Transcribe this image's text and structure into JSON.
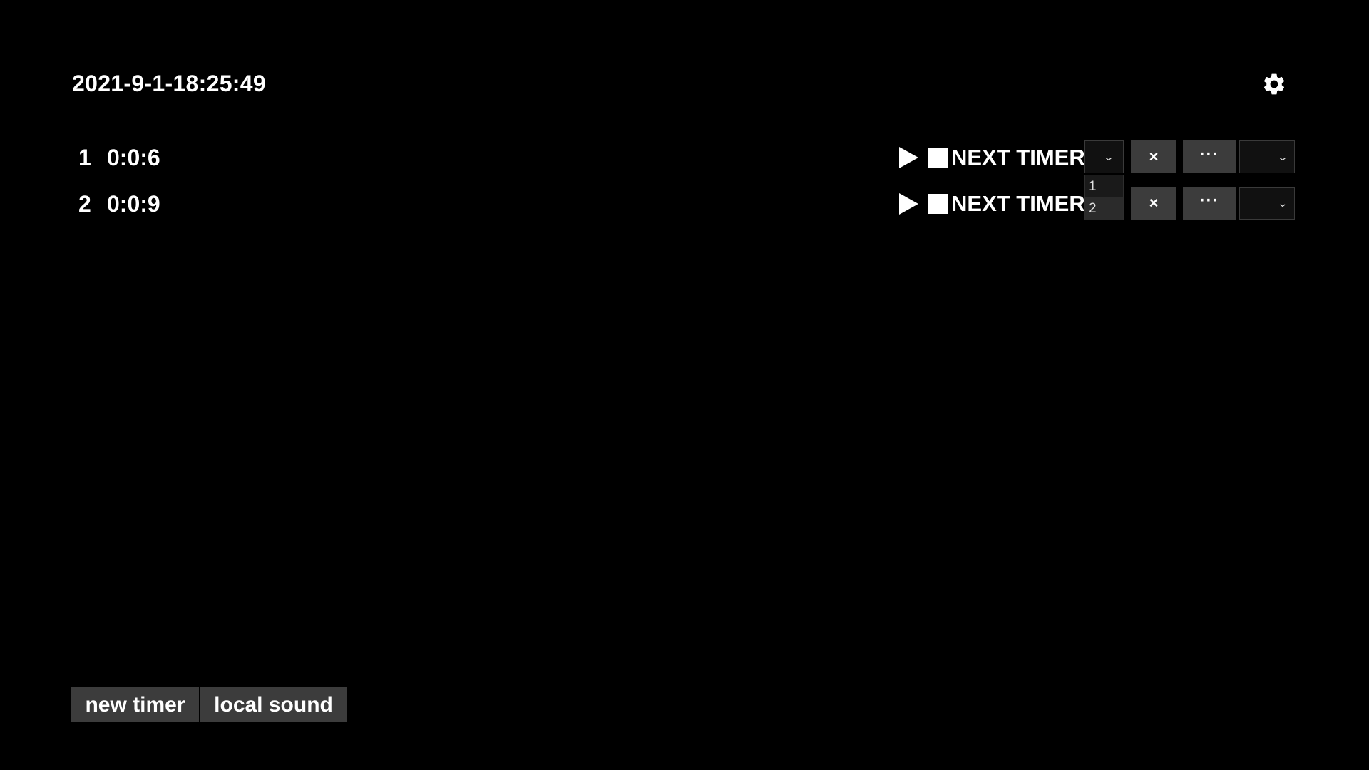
{
  "clock": {
    "datetime": "2021-9-1-18:25:49"
  },
  "header": {
    "settings_icon": "gear-icon"
  },
  "timers": [
    {
      "index": "1",
      "time": "0:0:6",
      "next_label": "NEXT TIMER",
      "delete_label": "×",
      "more_label": "···"
    },
    {
      "index": "2",
      "time": "0:0:9",
      "next_label": "NEXT TIMER",
      "delete_label": "×",
      "more_label": "···"
    }
  ],
  "next_timer_dropdown": {
    "options": [
      "1",
      "2"
    ],
    "highlighted": "2"
  },
  "footer": {
    "new_timer_label": "new timer",
    "local_sound_label": "local sound"
  },
  "colors": {
    "background": "#000000",
    "text": "#ffffff",
    "button": "#3c3c3c",
    "select": "#111111"
  }
}
